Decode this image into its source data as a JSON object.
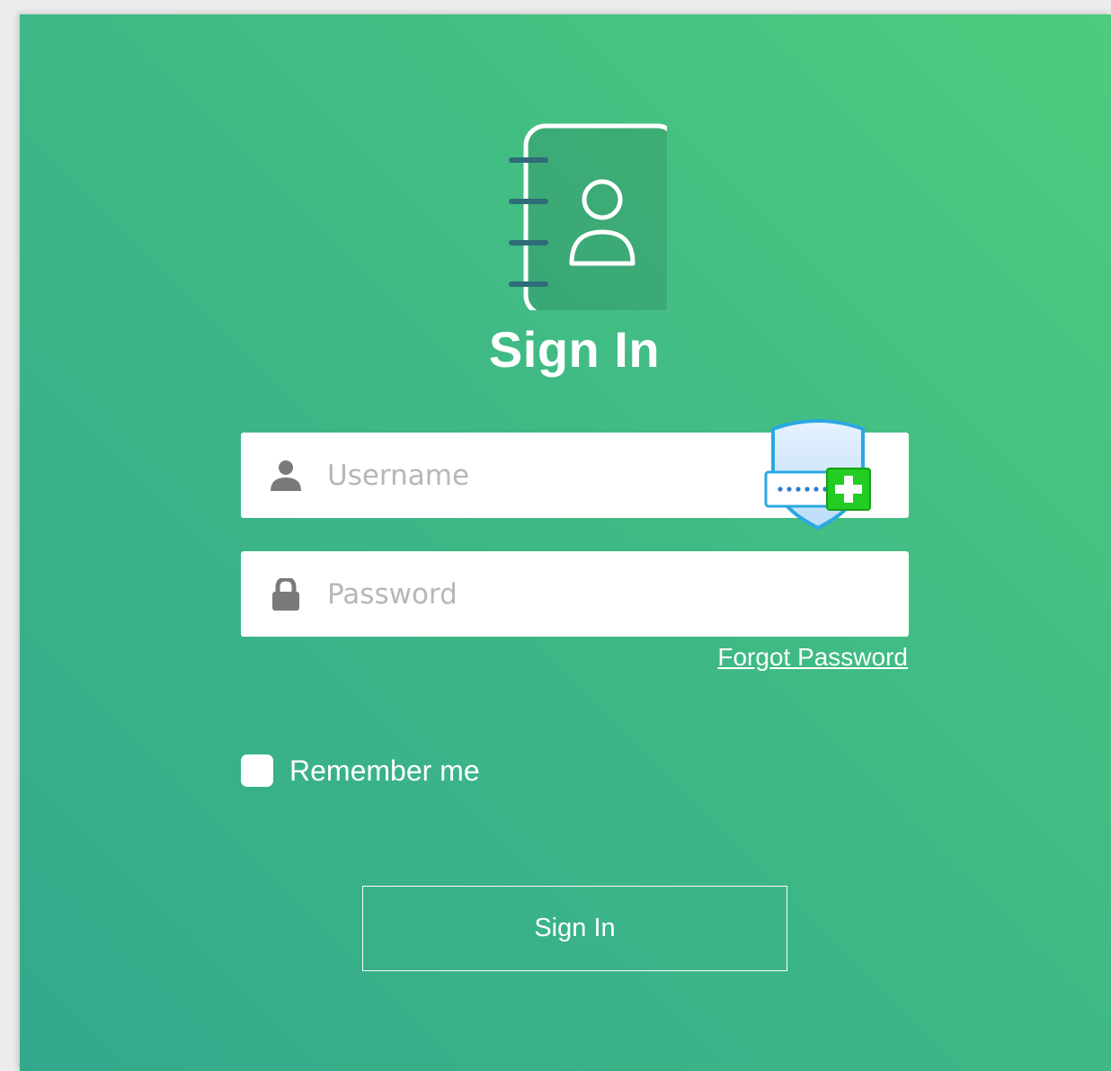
{
  "page": {
    "title": "Sign In"
  },
  "form": {
    "username_placeholder": "Username",
    "username_value": "",
    "password_placeholder": "Password",
    "password_value": "",
    "forgot_password_label": "Forgot Password",
    "remember_me_label": "Remember me",
    "remember_me_checked": false,
    "submit_label": "Sign In"
  },
  "icons": {
    "logo": "contact-book-icon",
    "username": "user-icon",
    "password": "lock-icon",
    "password_manager": "password-manager-shield-icon"
  },
  "colors": {
    "gradient_start": "#4ecb7e",
    "gradient_end": "#33a98c",
    "text": "#ffffff",
    "placeholder": "#b7b7b7",
    "icon_gray": "#7a7a7a",
    "badge_blue": "#2aa8e0",
    "badge_green": "#22cc22"
  }
}
